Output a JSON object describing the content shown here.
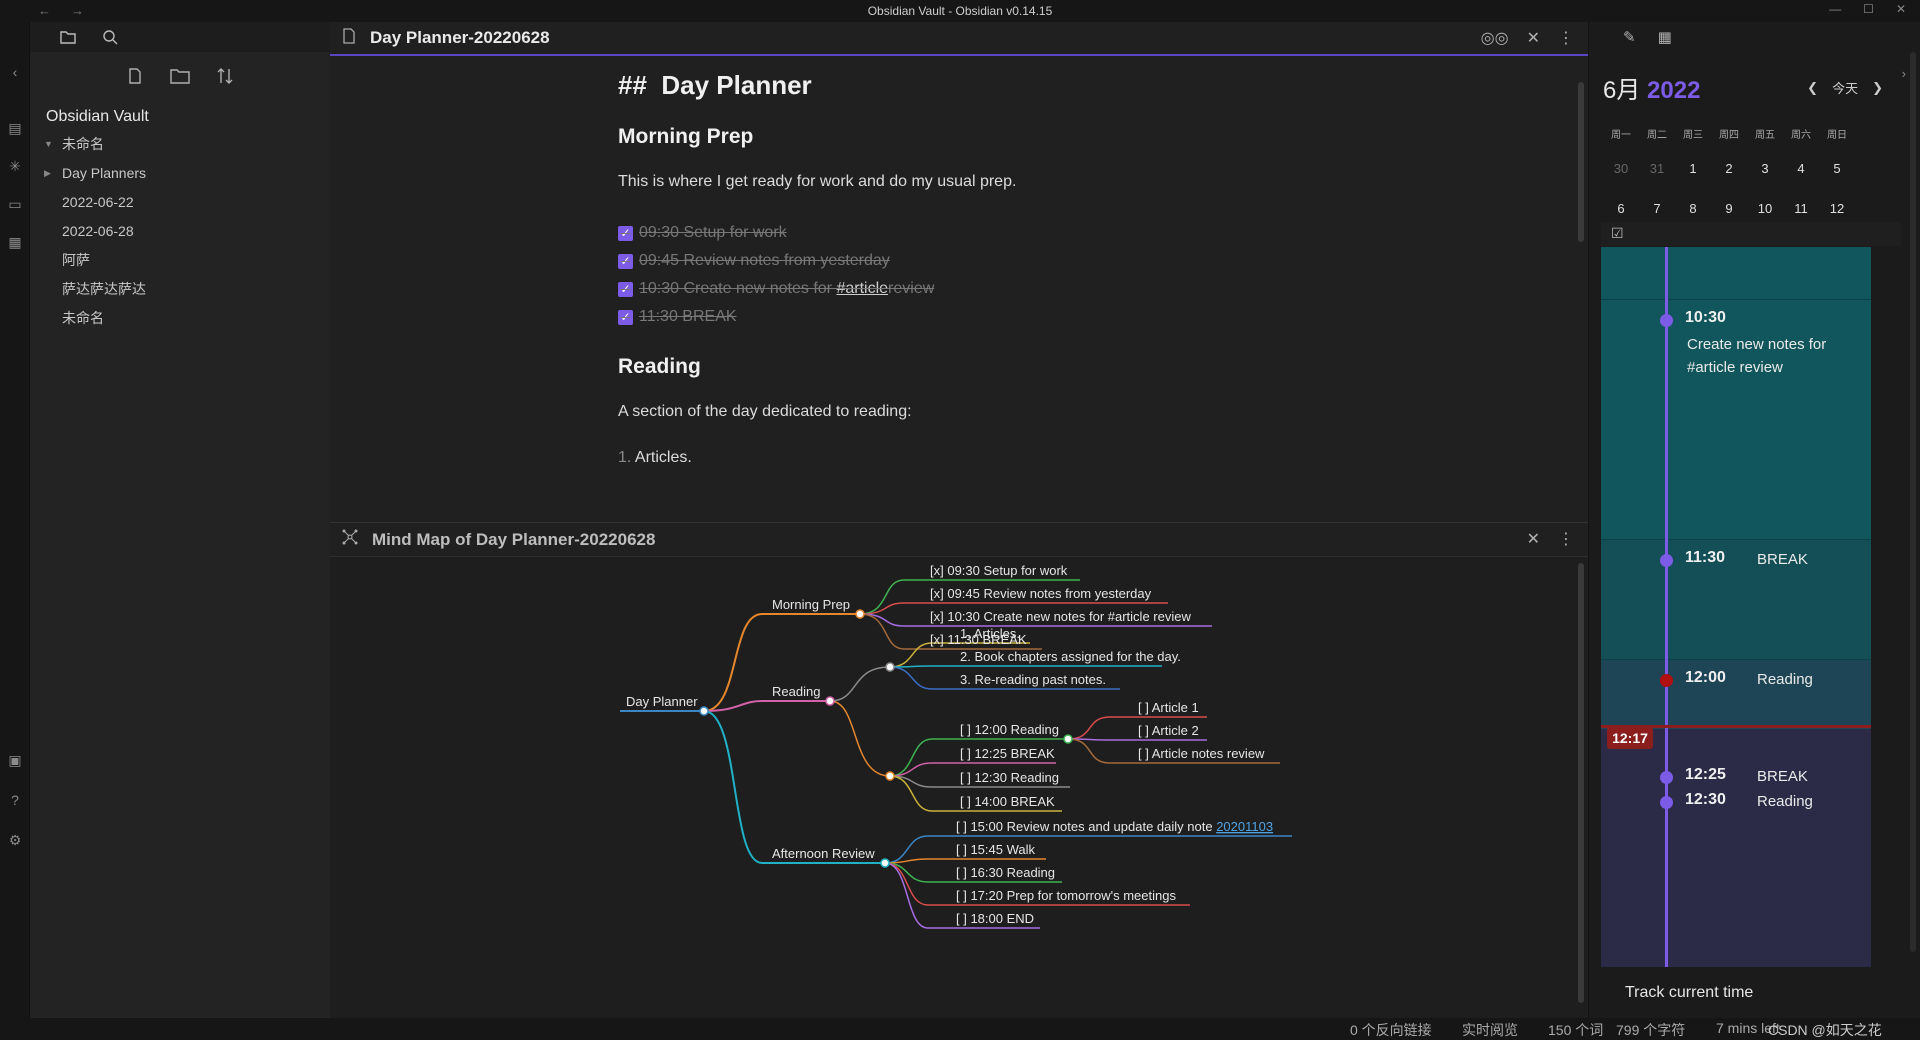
{
  "window": {
    "title": "Obsidian Vault - Obsidian v0.14.15"
  },
  "nav": {
    "back": "←",
    "forward": "→"
  },
  "file_explorer": {
    "vault_name": "Obsidian Vault",
    "items": [
      {
        "label": "未命名",
        "type": "folder",
        "expanded": true
      },
      {
        "label": "Day Planners",
        "type": "folder",
        "expanded": false
      },
      {
        "label": "2022-06-22",
        "type": "file"
      },
      {
        "label": "2022-06-28",
        "type": "file"
      },
      {
        "label": "阿萨",
        "type": "file"
      },
      {
        "label": "萨达萨达萨达",
        "type": "file"
      },
      {
        "label": "未命名",
        "type": "file"
      }
    ]
  },
  "editor": {
    "tab_title": "Day Planner-20220628",
    "heading_prefix": "##",
    "heading": "Day Planner",
    "section1": "Morning Prep",
    "section1_text": "This is where I get ready for work and do my usual prep.",
    "tasks": [
      {
        "text": "09:30 Setup for work",
        "done": true
      },
      {
        "text": "09:45 Review notes from yesterday",
        "done": true
      },
      {
        "before": "10:30 Create new notes for ",
        "tag": "#article",
        "after": " review",
        "done": true
      },
      {
        "text": "11:30 BREAK",
        "done": true
      }
    ],
    "section2": "Reading",
    "section2_text": "A section of the day dedicated to reading:",
    "list_num": "1.",
    "list_item": "Articles."
  },
  "mindmap": {
    "tab_title": "Mind Map of Day Planner-20220628",
    "root": "Day Planner",
    "branches": {
      "morning": "Morning Prep",
      "reading": "Reading",
      "afternoon": "Afternoon Review"
    },
    "morning_items": [
      "[x] 09:30 Setup for work",
      "[x] 09:45 Review notes from yesterday",
      "[x] 10:30 Create new notes for #article review",
      "[x] 11:30 BREAK"
    ],
    "reading_list": [
      "1. Articles.",
      "2. Book chapters assigned for the day.",
      "3. Re-reading past notes."
    ],
    "reading_tasks": [
      "[ ] 12:00 Reading",
      "[ ] 12:25 BREAK",
      "[ ] 12:30 Reading",
      "[ ] 14:00 BREAK"
    ],
    "reading_sub": [
      "[ ] Article 1",
      "[ ] Article 2",
      "[ ] Article notes review"
    ],
    "afternoon_first": "[ ] 15:00 Review notes and update daily note ",
    "afternoon_link": "20201103",
    "afternoon_items": [
      "[ ] 15:45 Walk",
      "[ ] 16:30 Reading",
      "[ ] 17:20 Prep for tomorrow's meetings",
      "[ ] 18:00 END"
    ]
  },
  "calendar": {
    "month": "6月",
    "year": "2022",
    "today_label": "今天",
    "weekdays": [
      "周一",
      "周二",
      "周三",
      "周四",
      "周五",
      "周六",
      "周日"
    ],
    "days": [
      {
        "n": "30",
        "muted": true
      },
      {
        "n": "31",
        "muted": true
      },
      {
        "n": "1"
      },
      {
        "n": "2"
      },
      {
        "n": "3"
      },
      {
        "n": "4"
      },
      {
        "n": "5"
      },
      {
        "n": "6"
      },
      {
        "n": "7"
      },
      {
        "n": "8"
      },
      {
        "n": "9"
      },
      {
        "n": "10"
      },
      {
        "n": "11"
      },
      {
        "n": "12"
      }
    ]
  },
  "timeline": {
    "entries": [
      {
        "time": "10:30",
        "text": "Create new notes for #article review"
      },
      {
        "time": "11:30",
        "text": "BREAK"
      },
      {
        "time": "12:00",
        "text": "Reading"
      },
      {
        "time": "12:25",
        "text": "BREAK"
      },
      {
        "time": "12:30",
        "text": "Reading"
      }
    ],
    "now": "12:17",
    "track_label": "Track current time"
  },
  "statusbar": {
    "backlinks": "0 个反向链接",
    "mode": "实时阅览",
    "words": "150 个词",
    "chars": "799 个字符",
    "read_time": "7 mins left"
  },
  "watermark": "CSDN @如天之花",
  "colors": {
    "accent": "#7c5ce6",
    "now": "#8b1d1d",
    "teal": "#11565c",
    "navy": "#2b2a47"
  }
}
